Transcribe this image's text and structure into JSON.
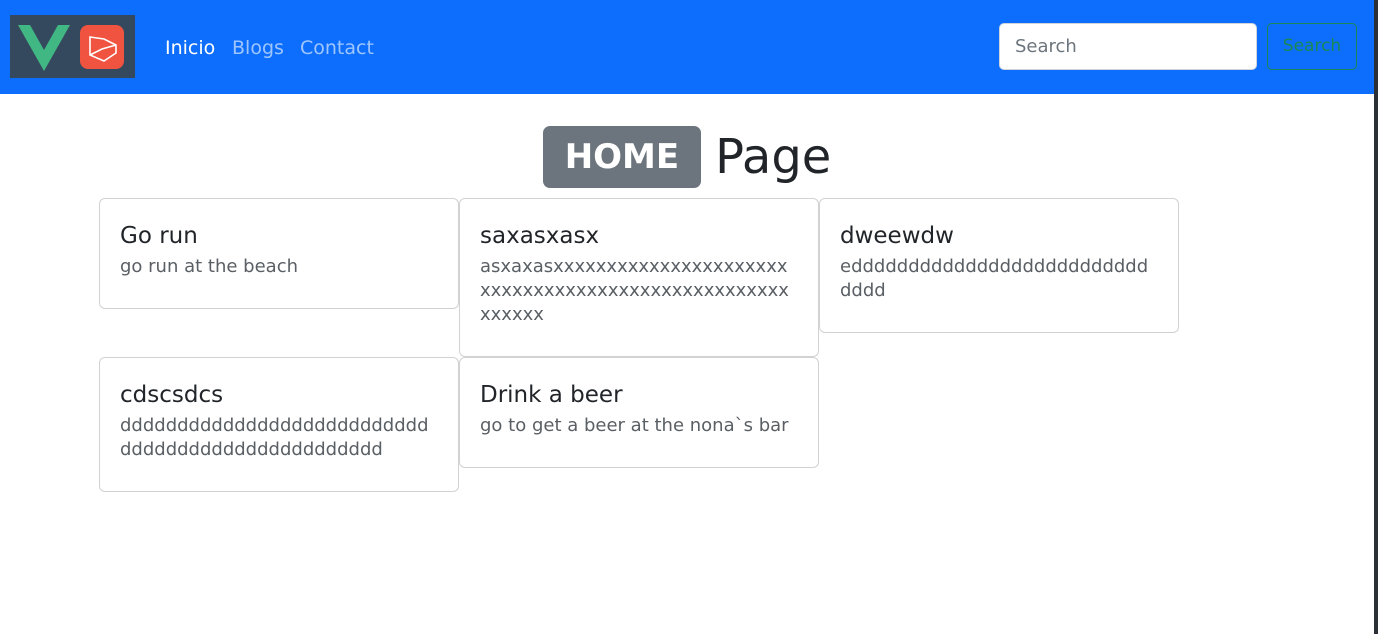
{
  "nav": {
    "links": [
      {
        "label": "Inicio"
      },
      {
        "label": "Blogs"
      },
      {
        "label": "Contact"
      }
    ],
    "search": {
      "placeholder": "Search",
      "value": "",
      "button_label": "Search"
    }
  },
  "heading": {
    "badge": "HOME",
    "text": "Page"
  },
  "cards": [
    {
      "title": "Go run",
      "text": "go run at the beach"
    },
    {
      "title": "saxasxasx",
      "text": "asxaxasxxxxxxxxxxxxxxxxxxxxxxxxxxxxxxxxxxxxxxxxxxxxxxxxxxxxxxxxx"
    },
    {
      "title": "dweewdw",
      "text": "edddddddddddddddddddddddddddddd"
    },
    {
      "title": "cdscsdcs",
      "text": "dddddddddddddddddddddddddddddddddddddddddddddddddd"
    },
    {
      "title": "Drink a beer",
      "text": "go to get a beer at the nona`s bar"
    }
  ],
  "colors": {
    "navbar": "#0d6efd",
    "badge": "#6c757d",
    "search_button": "#198754"
  }
}
